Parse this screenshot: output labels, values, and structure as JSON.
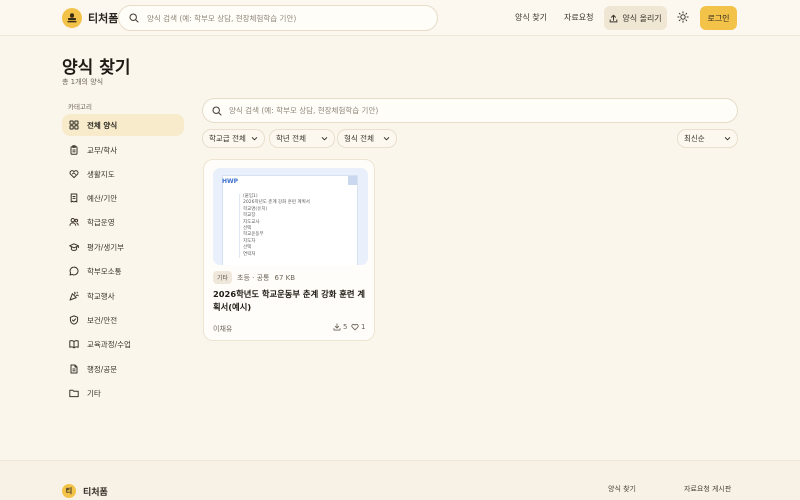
{
  "app": {
    "name": "티처폼",
    "footer_name": "티처폼",
    "footer_badge_letter": "티"
  },
  "header": {
    "search_placeholder": "양식 검색 (예: 학부모 상담, 현장체험학습 기안)",
    "nav": {
      "find": "양식 찾기",
      "requests": "자료요청",
      "upload": "양식 올리기",
      "login": "로그인"
    }
  },
  "page": {
    "title": "양식 찾기",
    "count": "총 1개의 양식"
  },
  "sidebar": {
    "category_label": "카테고리",
    "items": [
      {
        "label": "전체 양식",
        "icon": "grid-icon"
      },
      {
        "label": "교무/학사",
        "icon": "clipboard-icon"
      },
      {
        "label": "생활지도",
        "icon": "heart-handshake-icon"
      },
      {
        "label": "예산/기안",
        "icon": "receipt-icon"
      },
      {
        "label": "학급운영",
        "icon": "users-icon"
      },
      {
        "label": "평가/생기부",
        "icon": "graduation-cap-icon"
      },
      {
        "label": "학부모소통",
        "icon": "chat-icon"
      },
      {
        "label": "학교행사",
        "icon": "party-icon"
      },
      {
        "label": "보건/안전",
        "icon": "shield-icon"
      },
      {
        "label": "교육과정/수업",
        "icon": "book-icon"
      },
      {
        "label": "행정/공문",
        "icon": "document-icon"
      },
      {
        "label": "기타",
        "icon": "folder-icon"
      }
    ]
  },
  "main": {
    "search_placeholder": "양식 검색 (예: 학부모 상담, 현장체험학습 기안)",
    "filters": {
      "school": "학교급 전체",
      "grade": "학년 전체",
      "format": "형식 전체",
      "sort": "최신순"
    }
  },
  "card": {
    "thumb_badge": "HWP",
    "doc_lines": [
      "(붙임1)",
      "2026학년도 춘계 강화 훈련 계획서",
      "학교명(유치)",
      "학교장",
      "지도교사",
      "선택",
      "학교운동부",
      "지도자",
      "선택",
      "연락처"
    ],
    "tag": "기타",
    "meta": "초등 · 공통",
    "size": "67 KB",
    "title": "2026학년도 학교운동부 춘계 강화 훈련 계획서(예시)",
    "author": "이채유",
    "downloads": "5",
    "likes": "1"
  },
  "footer": {
    "links": {
      "find": "양식 찾기",
      "board": "자료요청 게시판"
    }
  },
  "colors": {
    "accent": "#f3c248",
    "background": "#fbf6ec",
    "active_item": "#f7ebcc",
    "hwp_blue": "#3c6fd0"
  }
}
